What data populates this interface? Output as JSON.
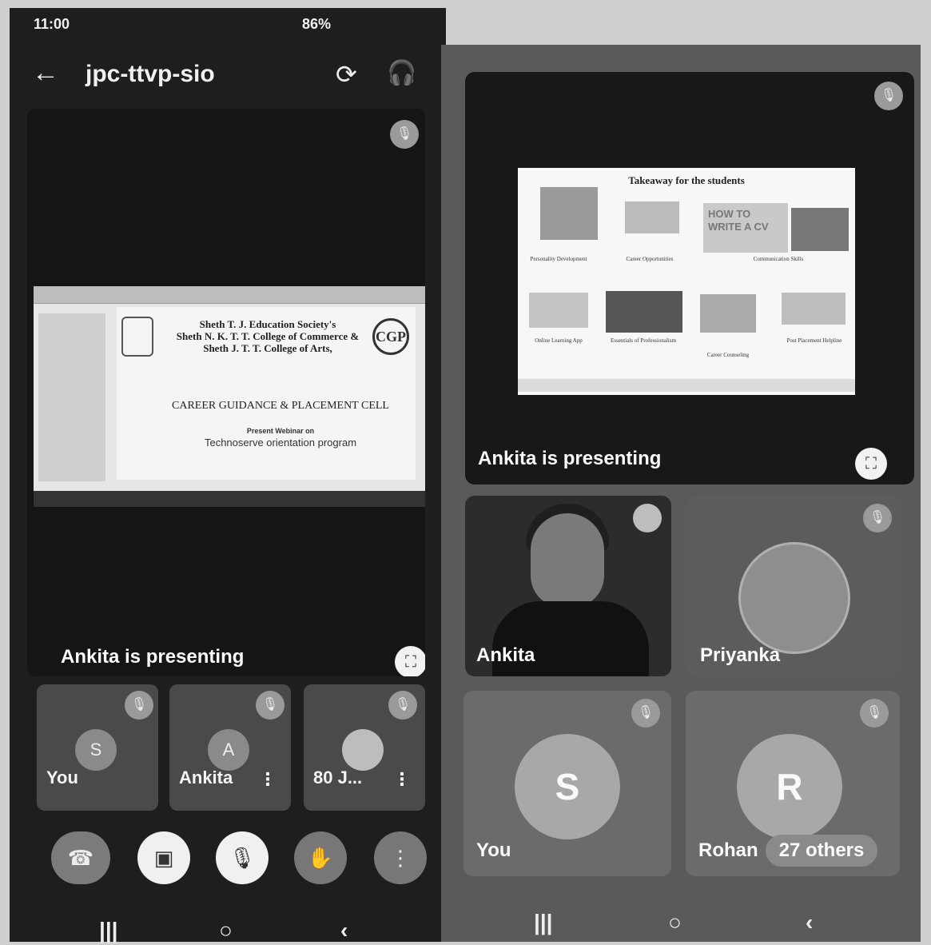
{
  "status_bar": {
    "time": "11:00",
    "battery": "86%"
  },
  "app_bar": {
    "meeting_code": "jpc-ttvp-sio"
  },
  "left": {
    "presenting_label": "Ankita is presenting",
    "slide": {
      "org_line1": "Sheth T. J. Education Society's",
      "org_line2": "Sheth N. K. T. T. College of Commerce &",
      "org_line3": "Sheth J. T. T. College of Arts,",
      "cell": "CAREER GUIDANCE & PLACEMENT CELL",
      "presents": "Present Webinar on",
      "program": "Technoserve orientation program",
      "logo_text": "CGP"
    },
    "participants": [
      {
        "name": "You",
        "initial": "S"
      },
      {
        "name": "Ankita",
        "initial": "A"
      },
      {
        "name": "80 J...",
        "initial": ""
      }
    ]
  },
  "right": {
    "presenting_label": "Ankita is presenting",
    "slide": {
      "title": "Takeaway for the students",
      "banner": "HOW TO WRITE A CV",
      "captions": [
        "Personality Development",
        "Career Opportunities",
        "Communication Skills",
        "Online Learning App",
        "Essentials of Professionalism",
        "Career Counseling",
        "Post Placement Helpline"
      ]
    },
    "tiles": [
      {
        "name": "Ankita"
      },
      {
        "name": "Priyanka"
      },
      {
        "name": "You",
        "initial": "S"
      },
      {
        "name": "Rohan",
        "initial": "R",
        "others": "27 others"
      }
    ]
  },
  "icons": {
    "back": "←",
    "switch_camera": "⟳",
    "headphones": "🎧",
    "mic_off": "🎙",
    "fullscreen": "⛶",
    "more": "⋮",
    "end_call": "☎",
    "camera_off": "▣",
    "raise_hand": "✋",
    "nav_recent": "|||",
    "nav_home": "○",
    "nav_back": "‹"
  }
}
